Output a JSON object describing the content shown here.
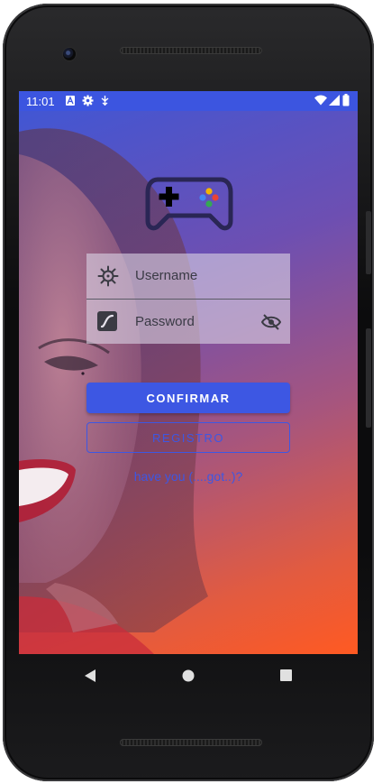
{
  "status_bar": {
    "time": "11:01",
    "left_icons": [
      "font-a-icon",
      "gear-icon",
      "usb-debug-icon"
    ],
    "right_icons": [
      "wifi-icon",
      "signal-icon",
      "battery-icon"
    ]
  },
  "login": {
    "logo_icon": "gamepad-icon",
    "username_placeholder": "Username",
    "password_placeholder": "Password",
    "confirm_label": "CONFIRMAR",
    "register_label": "REGISTRO",
    "forgot_link": "have you (....got..)?"
  },
  "nav": {
    "buttons": [
      "back-icon",
      "home-icon",
      "recents-icon"
    ]
  },
  "colors": {
    "accent": "#3d57e3",
    "status_bar": "#3c55e0",
    "gradient_top": "#3e57d6",
    "gradient_bottom": "#ff5a22"
  }
}
